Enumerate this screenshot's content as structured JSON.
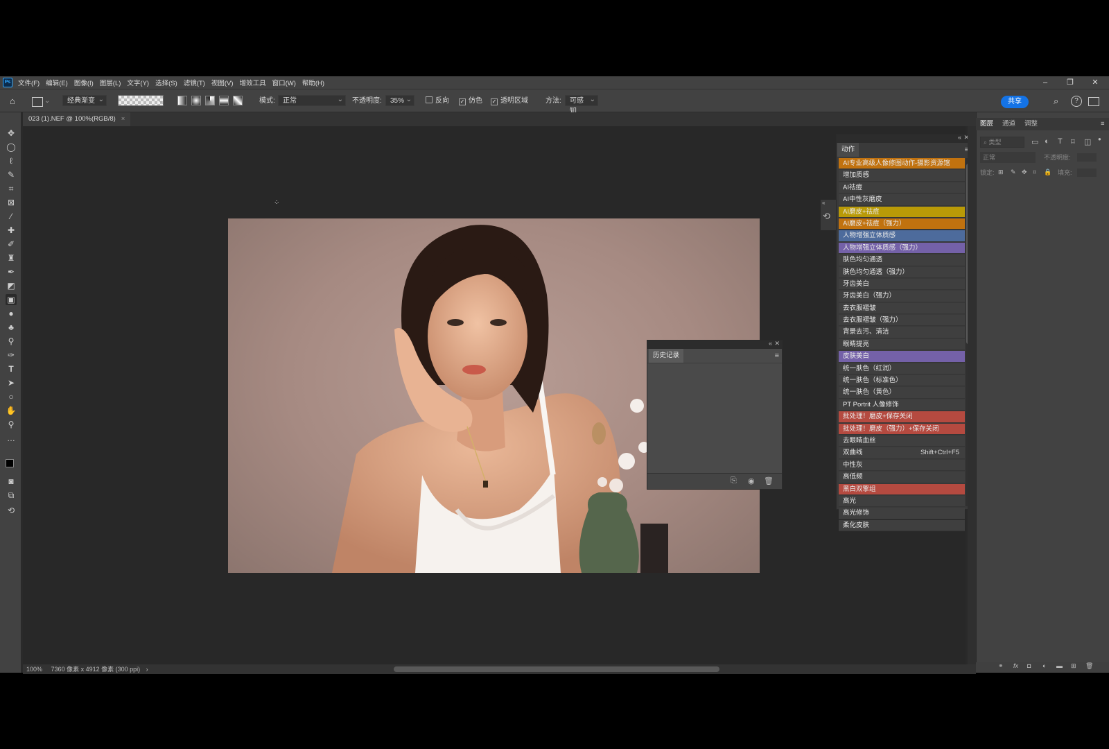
{
  "menu": {
    "logo": "Ps",
    "items": [
      "文件(F)",
      "编辑(E)",
      "图像(I)",
      "图层(L)",
      "文字(Y)",
      "选择(S)",
      "滤镜(T)",
      "视图(V)",
      "增效工具",
      "窗口(W)",
      "帮助(H)"
    ]
  },
  "options": {
    "gradient_type": "经典渐变",
    "mode_label": "模式:",
    "mode_value": "正常",
    "opacity_label": "不透明度:",
    "opacity_value": "35%",
    "reverse_label": "反向",
    "dither_label": "仿色",
    "transparency_label": "透明区域",
    "method_label": "方法:",
    "method_value": "可感知",
    "share_label": "共享"
  },
  "document": {
    "tab_title": "023 (1).NEF @ 100%(RGB/8)",
    "zoom": "100%",
    "info": "7360 像素 x 4912 像素 (300 ppi)"
  },
  "right_panel": {
    "tabs": [
      "图层",
      "通道",
      "调整"
    ],
    "search_placeholder": "类型",
    "blend_mode": "正常",
    "opacity_label": "不透明度:",
    "lock_label": "锁定:",
    "fill_label": "填充:"
  },
  "actions_panel": {
    "title": "动作",
    "items": [
      {
        "label": "AI专业高级人像修图动作-摄影资源馆",
        "color": "#c1720f"
      },
      {
        "label": "增加质感",
        "color": ""
      },
      {
        "label": "AI祛痘",
        "color": ""
      },
      {
        "label": "AI中性灰磨皮",
        "color": ""
      },
      {
        "label": "AI磨皮+祛痘",
        "color": "#b99a07"
      },
      {
        "label": "AI磨皮+祛痘（强力）",
        "color": "#c1720f"
      },
      {
        "label": "人物增强立体质感",
        "color": "#4d6b9c"
      },
      {
        "label": "人物增强立体质感（强力）",
        "color": "#7461a8"
      },
      {
        "label": "肤色均匀通透",
        "color": ""
      },
      {
        "label": "肤色均匀通透（强力）",
        "color": ""
      },
      {
        "label": "牙齿美白",
        "color": ""
      },
      {
        "label": "牙齿美白（强力）",
        "color": ""
      },
      {
        "label": "去衣服褶皱",
        "color": ""
      },
      {
        "label": "去衣服褶皱（强力）",
        "color": ""
      },
      {
        "label": "背景去污、清洁",
        "color": ""
      },
      {
        "label": "眼睛提亮",
        "color": ""
      },
      {
        "label": "皮肤美白",
        "color": "#7461a8"
      },
      {
        "label": "统一肤色（红润）",
        "color": ""
      },
      {
        "label": "统一肤色（标准色）",
        "color": ""
      },
      {
        "label": "统一肤色（黄色）",
        "color": ""
      },
      {
        "label": "PT Portrit 人像修饰",
        "color": ""
      },
      {
        "label": "批处理！磨皮+保存关闭",
        "color": "#b54a40"
      },
      {
        "label": "批处理！磨皮（强力）+保存关闭",
        "color": "#b54a40"
      },
      {
        "label": "去眼睛血丝",
        "color": ""
      },
      {
        "label": "双曲线",
        "color": "",
        "shortcut": "Shift+Ctrl+F5"
      },
      {
        "label": "中性灰",
        "color": ""
      },
      {
        "label": "高低频",
        "color": ""
      },
      {
        "label": "黑白双擎组",
        "color": "#b54a40"
      },
      {
        "label": "高光",
        "color": ""
      },
      {
        "label": "高光修饰",
        "color": ""
      },
      {
        "label": "柔化皮肤",
        "color": ""
      }
    ]
  },
  "history_panel": {
    "title": "历史记录"
  }
}
